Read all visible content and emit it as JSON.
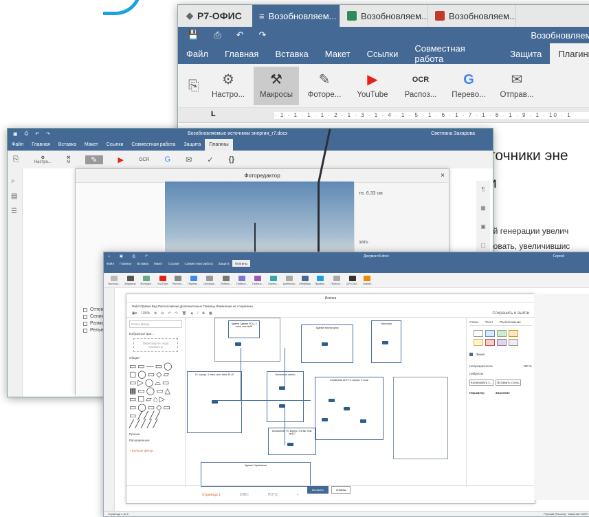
{
  "app_logo": "Р7-ОФИС",
  "tabs": [
    {
      "label": "Возобновляем...",
      "color": "#446995",
      "active": true
    },
    {
      "label": "Возобновляем...",
      "color": "#2e8b57",
      "active": false
    },
    {
      "label": "Возобновляем...",
      "color": "#c0392b",
      "active": false
    }
  ],
  "tab_close": "×",
  "doc_title": "Возобновляемые",
  "menu": [
    "Файл",
    "Главная",
    "Вставка",
    "Макет",
    "Ссылки",
    "Совместная работа",
    "Защита",
    "Плагины"
  ],
  "toolbar": [
    {
      "label": "Настро...",
      "icon": "settings-doc-icon",
      "glyph": "⚙"
    },
    {
      "label": "Макросы",
      "icon": "macros-icon",
      "glyph": "⚒"
    },
    {
      "label": "Фоторе...",
      "icon": "photo-editor-icon",
      "glyph": "✎"
    },
    {
      "label": "YouTube",
      "icon": "youtube-icon",
      "glyph": "▶"
    },
    {
      "label": "Распоз...",
      "icon": "ocr-icon",
      "glyph": "OCR"
    },
    {
      "label": "Перево...",
      "icon": "translate-icon",
      "glyph": "G"
    },
    {
      "label": "Отправ...",
      "icon": "mail-icon",
      "glyph": "✉"
    }
  ],
  "ruler_marks": "· 1 · 1 · 1 · 1 · 2 · 1 · 3 · 1 · 4 · 1 · 5 · 1 · 6 · 1 · 7 · 1 · 8 · 1 · 9 · 1 · 10 · 1",
  "body_heading_1": "точники эне",
  "body_heading_2": "и",
  "body_text_1": "ой генерации увелич",
  "body_text_2": "ровать, увеличившис",
  "winB": {
    "title": "Возобновляемые источники энергии_r7.docx",
    "user": "Светлана Захарова",
    "menu": [
      "Файл",
      "Главная",
      "Вставка",
      "Макет",
      "Ссылки",
      "Совместная работа",
      "Защита",
      "Плагины"
    ],
    "tool_first": "Настро...",
    "tool_second": "M",
    "dialog_title": "Фоторедактор",
    "dialog_close": "×",
    "right_value": "тв. 6.33 см",
    "right_ctrl": "зать",
    "checks": [
      "Оттене...",
      "Сепия",
      "Размыт...",
      "Рельеф..."
    ]
  },
  "winC": {
    "title": "Документ3.docx",
    "user": "Сергей",
    "menu": [
      "Файл",
      "Главная",
      "Вставка",
      "Макет",
      "Ссылки",
      "Совместная работа",
      "Защита",
      "Плагины"
    ],
    "tools": [
      "Настро...",
      "Макросы",
      "Фоторе...",
      "YouTube",
      "Распоз...",
      "Перево...",
      "Отправ...",
      "Подпис...",
      "Подпис...",
      "Подпис...",
      "Пакет...",
      "Шаблоны",
      "MindMap",
      "Провер...",
      "Подпис...",
      "QR Cod...",
      "Drawio"
    ],
    "drawio": {
      "title": "Иконка",
      "menu": "Файл  Правка  Вид  Расположение  Дополнительно  Помощь  Изменения не сохранены.",
      "zoom": "100%",
      "save": "Сохранить и выйти",
      "search_placeholder": "Поиск фигур",
      "favorites": "Избранные фиг...",
      "drop_hint": "Перетащите сюда элементы",
      "general": "Общие",
      "misc": "Прочее",
      "advanced": "Расширенные",
      "more_shapes": "+ Больше фигур...",
      "pages": [
        "Страница 1",
        "КЛВС",
        "ПОТД"
      ],
      "style_tabs": [
        "Стиль",
        "Текст",
        "Расположение"
      ],
      "line_label": "Линия",
      "opacity_label": "Непрозрачность",
      "opacity_value": "100 %",
      "sketch_label": "Набросок",
      "copy_style": "Копировать с...",
      "paste_style": "Вставить стиль",
      "param_label": "Параметр",
      "value_label": "Значение",
      "nodes": [
        "Здание Здание РСЦ, 2 этаж, пом №45",
        "Здание электроцеха",
        "Насосная",
        "Гл. корпус, 1 этаж, пом. №№ 39-40",
        "Начальник смены",
        "Серверная АСУ Гл. корпус, 2 этаж",
        "Аппаратная Гл. корпус, 3 этаж, пом. №417",
        "Здание Управления"
      ]
    },
    "insert": "Вставить",
    "cancel": "Отмена",
    "status_left": "Страница 1 из 1",
    "status_right": "Русский (Россия)  ·  Масштаб 100%"
  }
}
